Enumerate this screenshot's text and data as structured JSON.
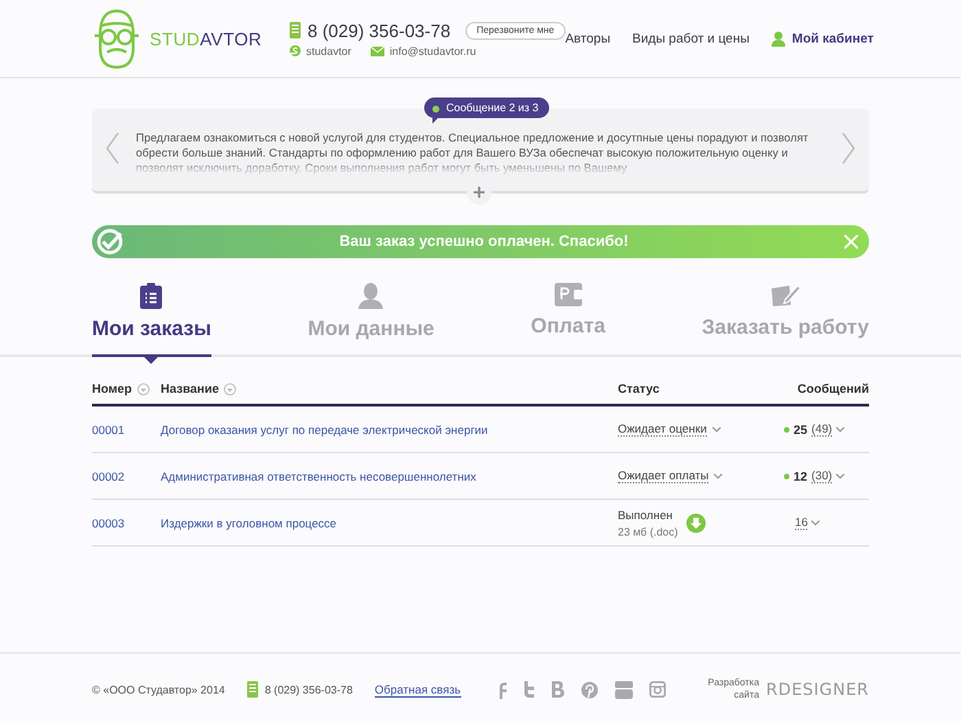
{
  "header": {
    "logo": {
      "part_1": "STUD",
      "part_2": "AVTOR"
    },
    "phone": "8 (029) 356-03-78",
    "callback_button": "Перезвоните мне",
    "skype": "studavtor",
    "email": "info@studavtor.ru",
    "nav": [
      {
        "label": "Авторы",
        "kind": "link"
      },
      {
        "label": "Виды работ и цены",
        "kind": "link"
      },
      {
        "label": "Мой кабинет",
        "kind": "account"
      }
    ]
  },
  "message": {
    "badge": "Сообщение 2 из 3",
    "text": "Предлагаем ознакомиться с новой услугой для студентов. Специальное предложение и досутпные цены порадуют и позволят обрести больше знаний. Стандарты по оформлению работ для Вашего ВУЗа обеспечат высокую положительную оценку и позволят исключить доработку. Сроки выполнения работ могут быть уменьшены по Вашему"
  },
  "notice": {
    "text": "Ваш заказ успешно оплачен. Спасибо!"
  },
  "tabs": [
    {
      "label": "Мои заказы",
      "selected": true,
      "kind": "orders"
    },
    {
      "label": "Мои данные",
      "selected": false,
      "kind": "profile"
    },
    {
      "label": "Оплата",
      "selected": false,
      "kind": "payment"
    },
    {
      "label": "Заказать работу",
      "selected": false,
      "kind": "new"
    }
  ],
  "table": {
    "columns": [
      {
        "label": "Номер",
        "sortable": true
      },
      {
        "label": "Название",
        "sortable": true
      },
      {
        "label": "Статус",
        "sortable": false
      },
      {
        "label": "Сообщений",
        "sortable": false
      }
    ],
    "rows": [
      {
        "number": "00001",
        "title": "Договор оказания услуг по передаче электрической энергии",
        "kind": "pending",
        "status": "Ожидает оценки",
        "messages": {
          "unread": true,
          "count": "25",
          "total": "(49)"
        }
      },
      {
        "number": "00002",
        "title": "Административная ответственность несовершеннолетних",
        "kind": "pending",
        "status": "Ожидает оплаты",
        "messages": {
          "unread": true,
          "count": "12",
          "total": "(30)"
        }
      },
      {
        "number": "00003",
        "title": "Издержки в уголовном процессе",
        "kind": "done",
        "status": "Выполнен",
        "file": "23 мб (.doc)",
        "messages": {
          "unread": false,
          "count": "16"
        }
      }
    ]
  },
  "footer": {
    "copyright": "© «ООО Студавтор» 2014",
    "phone": "8 (029) 356-03-78",
    "feedback_link": "Обратная связь",
    "credit": "Разработка сайта",
    "developer": "RDESIGNER"
  }
}
